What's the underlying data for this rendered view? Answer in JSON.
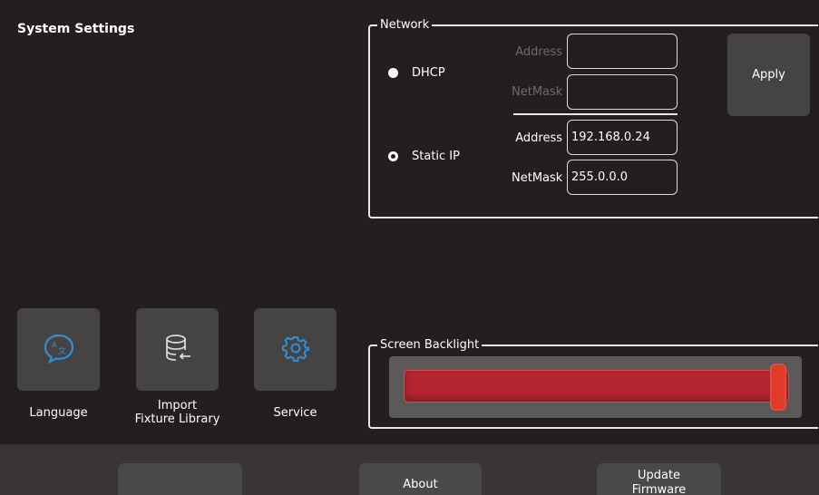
{
  "page": {
    "title": "System Settings"
  },
  "network": {
    "legend": "Network",
    "dhcp": {
      "label": "DHCP",
      "selected": false
    },
    "static_ip": {
      "label": "Static IP",
      "selected": true
    },
    "dhcp_address_label": "Address",
    "dhcp_address_value": "",
    "dhcp_netmask_label": "NetMask",
    "dhcp_netmask_value": "",
    "static_address_label": "Address",
    "static_address_value": "192.168.0.24",
    "static_netmask_label": "NetMask",
    "static_netmask_value": "255.0.0.0",
    "apply_label": "Apply"
  },
  "tools": [
    {
      "label": "Language",
      "icon": "language-icon"
    },
    {
      "label": "Import\nFixture Library",
      "icon": "database-import-icon"
    },
    {
      "label": "Service",
      "icon": "gear-icon"
    }
  ],
  "backlight": {
    "legend": "Screen Backlight",
    "level": 1.0
  },
  "bottom_bar": {
    "blank_label": "",
    "about_label": "About",
    "update_firmware_label": "Update\nFirmware"
  },
  "colors": {
    "background": "#231f20",
    "panel": "#464343",
    "accent_icon": "#2f8fd6",
    "slider_fill": "#b4242e",
    "slider_handle": "#e03a2a"
  }
}
